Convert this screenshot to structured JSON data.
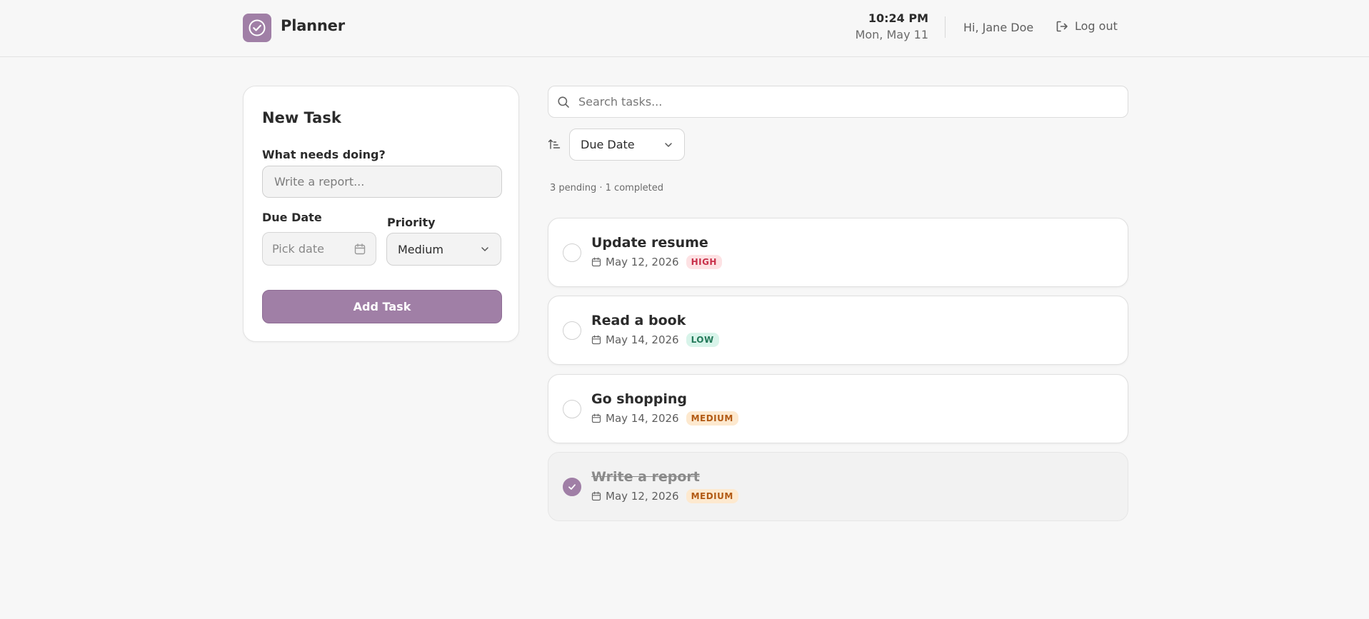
{
  "header": {
    "brand": "Planner",
    "time": "10:24 PM",
    "date": "Mon, May 11",
    "greeting": "Hi, Jane Doe",
    "logout_label": "Log out"
  },
  "new_task": {
    "title": "New Task",
    "task_label": "What needs doing?",
    "task_placeholder": "Write a report...",
    "due_label": "Due Date",
    "due_placeholder": "Pick date",
    "priority_label": "Priority",
    "priority_value": "Medium",
    "add_label": "Add Task"
  },
  "list": {
    "search_placeholder": "Search tasks...",
    "sort_value": "Due Date",
    "summary": "3 pending · 1 completed",
    "tasks": [
      {
        "title": "Update resume",
        "date": "May 12, 2026",
        "priority": "HIGH",
        "completed": false
      },
      {
        "title": "Read a book",
        "date": "May 14, 2026",
        "priority": "LOW",
        "completed": false
      },
      {
        "title": "Go shopping",
        "date": "May 14, 2026",
        "priority": "MEDIUM",
        "completed": false
      },
      {
        "title": "Write a report",
        "date": "May 12, 2026",
        "priority": "MEDIUM",
        "completed": true
      }
    ]
  },
  "colors": {
    "accent": "#a07fa6",
    "background": "#f7f7f7",
    "high": "#c8304a",
    "low": "#247a5a",
    "medium": "#b25a14"
  },
  "icons": {
    "logo": "check-circle-icon",
    "logout": "logout-icon",
    "calendar": "calendar-icon",
    "search": "search-icon",
    "sort": "sort-ascending-icon",
    "dropdown": "chevron-down-icon",
    "checkbox_done": "check-icon"
  }
}
